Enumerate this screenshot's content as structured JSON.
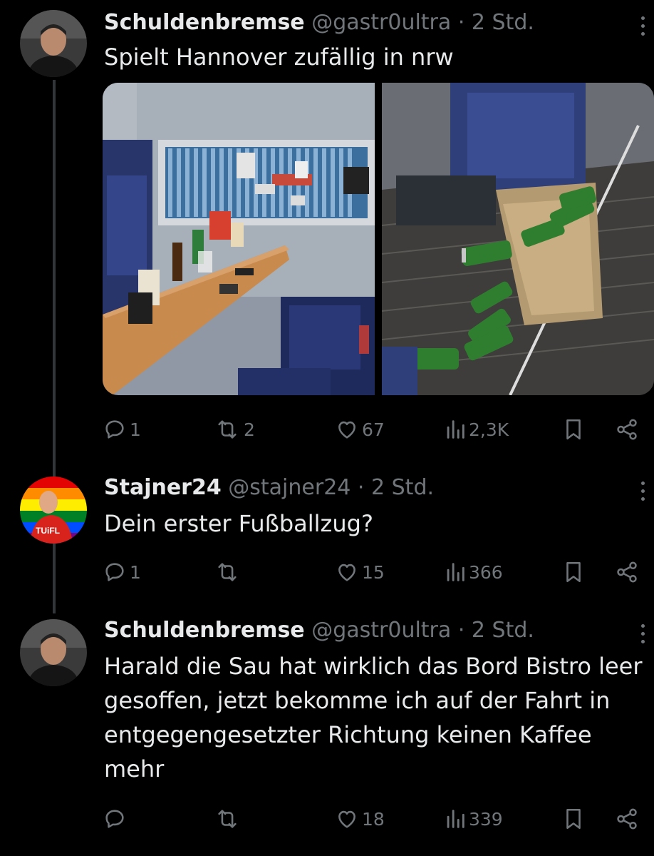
{
  "tweets": [
    {
      "name": "Schuldenbremse",
      "handle": "@gastr0ultra",
      "dot": "·",
      "time": "2 Std.",
      "text": "Spielt Hannover zufällig in nrw",
      "stats": {
        "replies": "1",
        "reposts": "2",
        "likes": "67",
        "views": "2,3K"
      }
    },
    {
      "name": "Stajner24",
      "handle": "@stajner24",
      "dot": "·",
      "time": "2 Std.",
      "text": "Dein erster Fußballzug?",
      "stats": {
        "replies": "1",
        "reposts": "",
        "likes": "15",
        "views": "366"
      }
    },
    {
      "name": "Schuldenbremse",
      "handle": "@gastr0ultra",
      "dot": "·",
      "time": "2 Std.",
      "text": "Harald die Sau hat wirklich das Bord Bistro leer gesoffen, jetzt bekomme ich auf der Fahrt in entgegengesetzter Richtung keinen Kaffee mehr",
      "stats": {
        "replies": "",
        "reposts": "",
        "likes": "18",
        "views": "339"
      }
    }
  ],
  "icons": {
    "reply": "reply-icon",
    "repost": "repost-icon",
    "like": "like-icon",
    "views": "views-icon",
    "bookmark": "bookmark-icon",
    "share": "share-icon",
    "more": "more-icon"
  },
  "colors": {
    "background": "#000000",
    "text": "#e7e9ea",
    "muted": "#71767b",
    "thread_line": "#333639"
  }
}
